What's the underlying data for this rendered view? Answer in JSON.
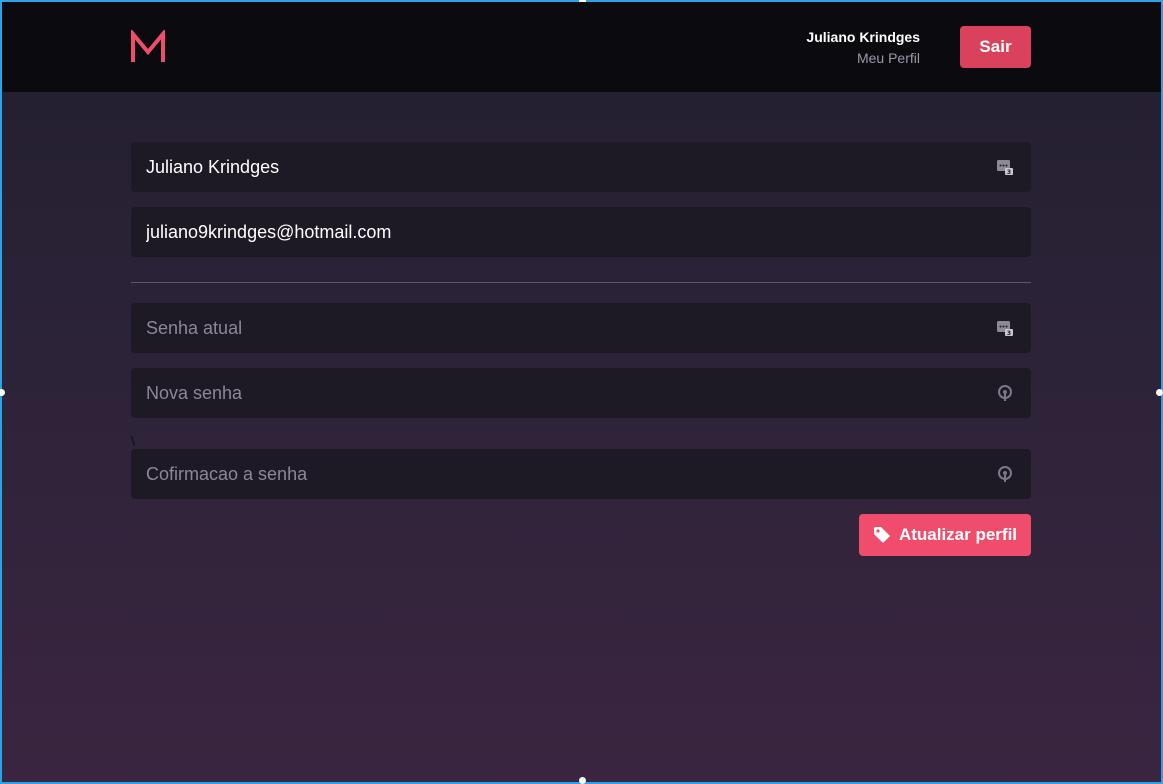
{
  "header": {
    "logo_icon": "m-logo-icon",
    "user_name": "Juliano Krindges",
    "profile_link": "Meu Perfil",
    "logout_label": "Sair"
  },
  "form": {
    "name": {
      "value": "Juliano Krindges",
      "placeholder": "",
      "icon": "password-manager-icon"
    },
    "email": {
      "value": "juliano9krindges@hotmail.com",
      "placeholder": ""
    },
    "current_password": {
      "value": "",
      "placeholder": "Senha atual",
      "icon": "password-manager-icon"
    },
    "new_password": {
      "value": "",
      "placeholder": "Nova senha",
      "icon": "key-icon"
    },
    "stray_char": "\\",
    "confirm_password": {
      "value": "",
      "placeholder": "Cofirmacao a senha",
      "icon": "key-icon"
    },
    "submit_label": "Atualizar perfil",
    "submit_icon": "tag-icon"
  },
  "colors": {
    "accent": "#ef4d6b",
    "logout": "#d9415d",
    "header_bg": "#0b0a0f",
    "field_bg": "#1d1925",
    "selection_border": "#2ba3e6"
  }
}
